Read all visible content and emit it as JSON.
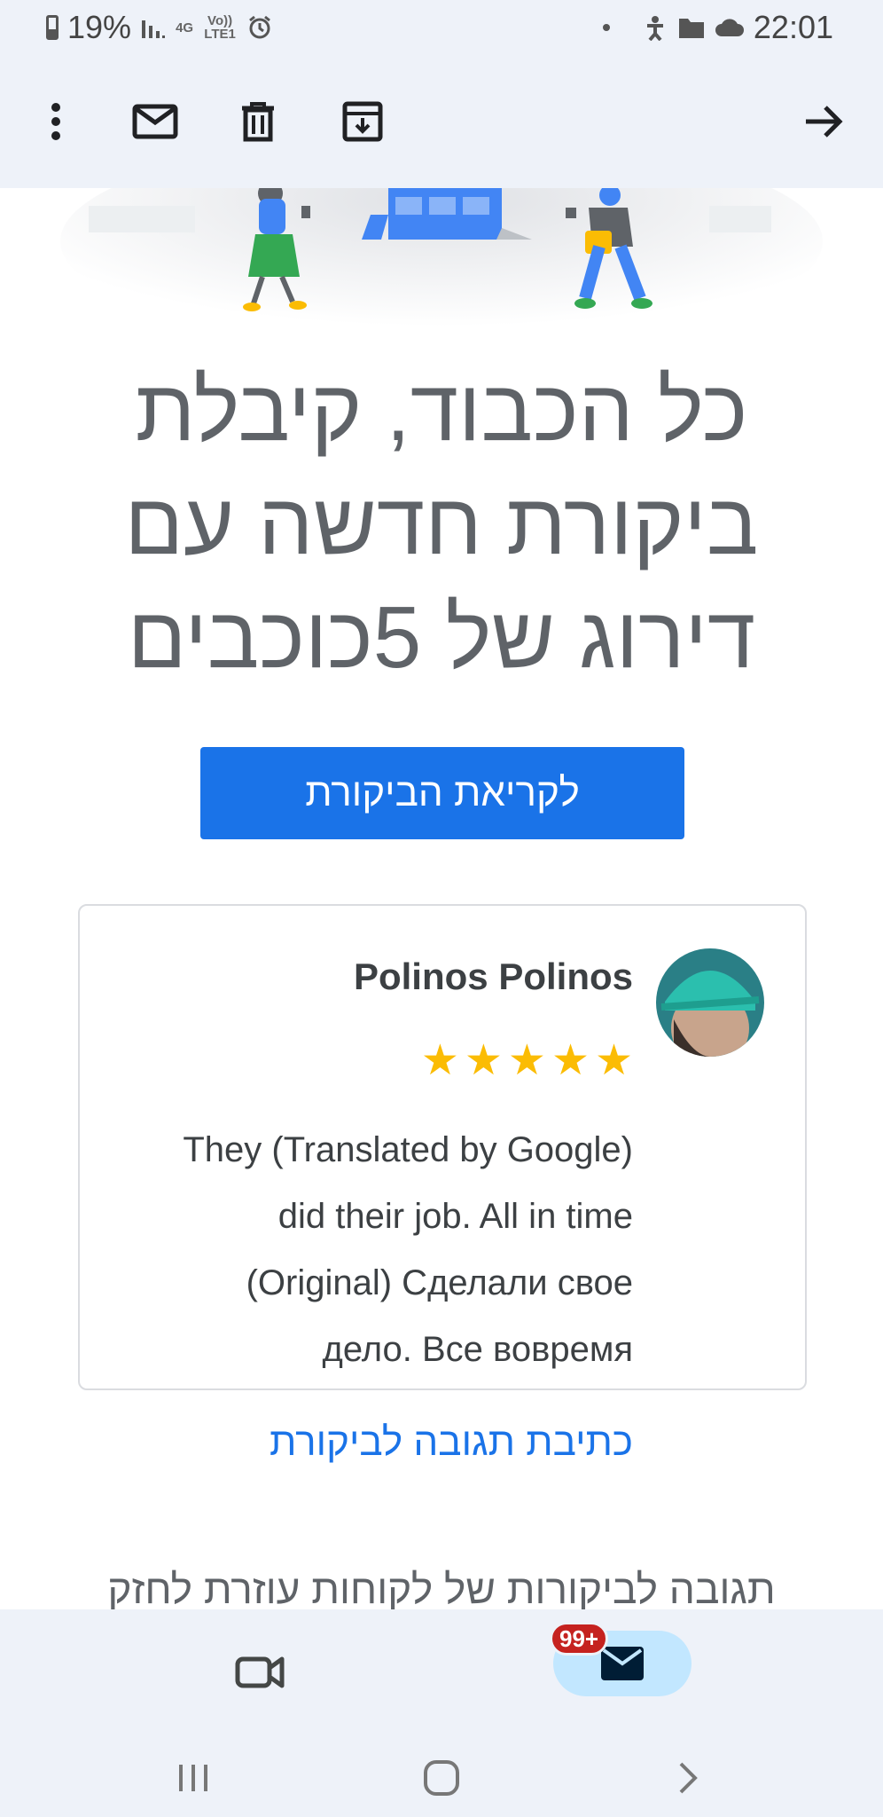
{
  "status_bar": {
    "battery": "19%",
    "network": "4G",
    "volte": "Vo)) LTE1",
    "time": "22:01"
  },
  "toolbar": {
    "icons": [
      "more-vert-icon",
      "mark-unread-icon",
      "delete-icon",
      "archive-icon",
      "forward-icon"
    ]
  },
  "email": {
    "headline_lines": [
      "כל הכבוד, קיבלת",
      "ביקורת חדשה עם",
      "דירוג של 5כוכבים"
    ],
    "cta_label": "לקריאת הביקורת",
    "review": {
      "reviewer_name": "Polinos Polinos",
      "rating": 5,
      "text_lines": [
        "They (Translated by Google)",
        "did their job. All in time",
        "(Original) Сделали свое",
        "дело. Все вовремя"
      ],
      "reply_label": "כתיבת תגובה לביקורת"
    },
    "footer_text_cut": "תגובה לביקורות של לקוחות עוזרת לחזק"
  },
  "bottom_nav": {
    "mail_badge": "99+"
  },
  "colors": {
    "accent": "#1a73e8",
    "star": "#fbbc04",
    "badge": "#c5221f",
    "bar_bg": "#eef2f9"
  }
}
